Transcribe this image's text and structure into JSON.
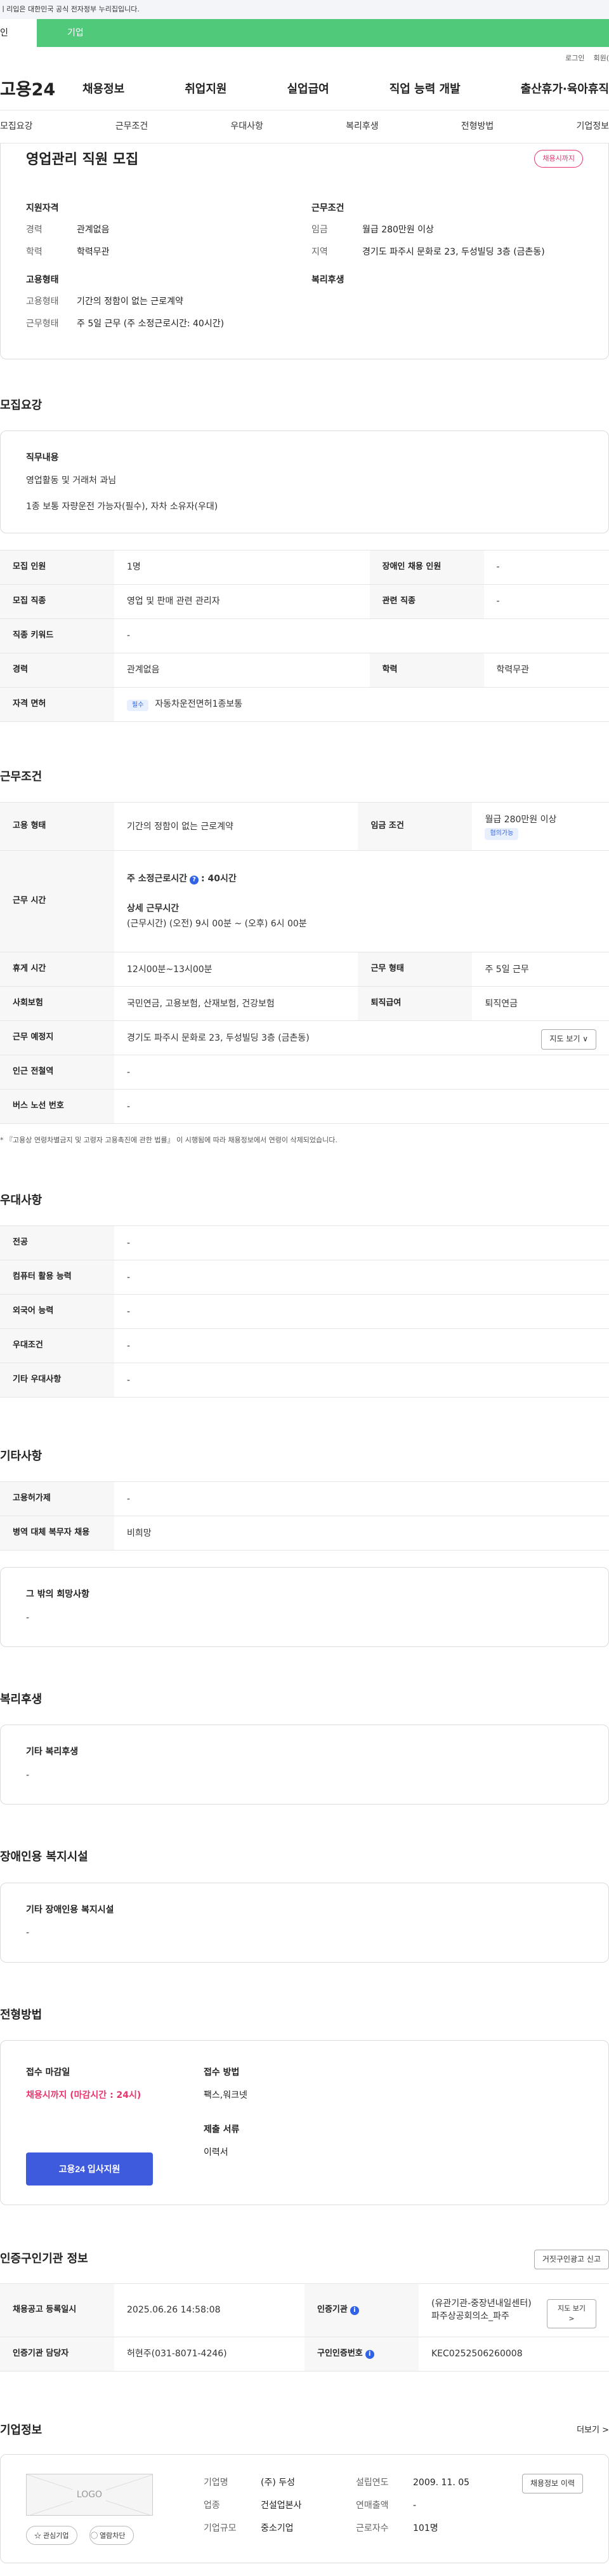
{
  "gov_bar": {
    "text": "ㅣ리입은 대한민국 공식 전자정부 누리집입니다."
  },
  "user_tabs": {
    "individual": "인",
    "company": "기업"
  },
  "util": {
    "login": "로그인",
    "signup": "회원("
  },
  "gnb": {
    "logo": "고용24",
    "items": [
      "채용정보",
      "취업지원",
      "실업급여",
      "직업 능력 개발",
      "출산휴가·육아휴직"
    ]
  },
  "subnav": {
    "items": [
      "모집요강",
      "근무조건",
      "우대사항",
      "복리후생",
      "전형방법",
      "기업정보"
    ]
  },
  "summary": {
    "title": "영업관리 직원 모집",
    "status": "채용시까지",
    "qual": {
      "heading": "지원자격",
      "rows": [
        {
          "k": "경력",
          "v": "관계없음"
        },
        {
          "k": "학력",
          "v": "학력무관"
        }
      ]
    },
    "cond": {
      "heading": "근무조건",
      "rows": [
        {
          "k": "임금",
          "v": "월급 280만원 이상"
        },
        {
          "k": "지역",
          "v": "경기도 파주시 문화로 23, 두성빌딩 3층 (금촌동)"
        }
      ]
    },
    "employ": {
      "heading": "고용형태",
      "rows": [
        {
          "k": "고용형태",
          "v": "기간의 정함이 없는 근로계약"
        },
        {
          "k": "근무형태",
          "v": "주 5일 근무 (주 소정근로시간: 40시간)"
        }
      ]
    },
    "welfare": {
      "heading": "복리후생"
    }
  },
  "recruit": {
    "title": "모집요강",
    "duty": {
      "heading": "직무내용",
      "lines": [
        "영업활동 및 거래처 과님",
        "1종 보통 자량운전 가능자(필수), 자차 소유자(우대)"
      ]
    },
    "rows": [
      {
        "k1": "모집 인원",
        "v1": "1명",
        "k2": "장애인 채용 인원",
        "v2": "-"
      },
      {
        "k1": "모집 직종",
        "v1": "영업 및 판매 관련 관리자",
        "k2": "관련 직종",
        "v2": "-"
      },
      {
        "k1": "직종 키워드",
        "v1": "-"
      },
      {
        "k1": "경력",
        "v1": "관계없음",
        "k2": "학력",
        "v2": "학력무관"
      },
      {
        "k1": "자격 면허",
        "v1": "자동차운전면허1종보통",
        "tag": "필수"
      }
    ]
  },
  "working": {
    "title": "근무조건",
    "employ_type": {
      "k": "고용 형태",
      "v": "기간의 정함이 없는 근로계약"
    },
    "wage": {
      "k": "임금 조건",
      "v": "월급 280만원 이상",
      "tag": "협의가능"
    },
    "hours": {
      "k": "근무 시간",
      "weekly": "주 소정근로시간",
      "weekly_val": ": 40시간",
      "detail_h": "상세 근무시간",
      "detail_v": "(근무시간) (오전) 9시 00분 ~ (오후) 6시 00분"
    },
    "rest": {
      "k": "휴게 시간",
      "v": "12시00분~13시00분",
      "k2": "근무 형태",
      "v2": "주 5일 근무"
    },
    "insurance": {
      "k": "사회보험",
      "v": "국민연금, 고용보험, 산재보험, 건강보험",
      "k2": "퇴직급여",
      "v2": "퇴직연금"
    },
    "place": {
      "k": "근무 예정지",
      "v": "경기도 파주시 문화로 23, 두성빌딩 3층 (금촌동)",
      "btn": "지도 보기 ∨"
    },
    "station": {
      "k": "인근 전철역",
      "v": "-"
    },
    "bus": {
      "k": "버스 노선 번호",
      "v": "-"
    },
    "note": "* 『고용상 연령차별금지 및 고령자 고용촉진에 관한 법률』 이 시행됨에 따라 채용정보에서 연령이 삭제되었습니다."
  },
  "prefer": {
    "title": "우대사항",
    "rows": [
      {
        "k": "전공",
        "v": "-"
      },
      {
        "k": "컴퓨터 활용 능력",
        "v": "-"
      },
      {
        "k": "외국어 능력",
        "v": "-"
      },
      {
        "k": "우대조건",
        "v": "-"
      },
      {
        "k": "기타 우대사항",
        "v": "-"
      }
    ]
  },
  "etc": {
    "title": "기타사항",
    "rows": [
      {
        "k": "고용허가제",
        "v": "-"
      },
      {
        "k": "병역 대체 복무자 채용",
        "v": "비희망"
      }
    ],
    "other": {
      "h": "그 밖의 희망사항",
      "v": "-"
    }
  },
  "welfare": {
    "title": "복리후생",
    "h": "기타 복리후생",
    "v": "-"
  },
  "disabled": {
    "title": "장애인용 복지시설",
    "h": "기타 장애인용 복지시설",
    "v": "-"
  },
  "selection": {
    "title": "전형방법",
    "deadline_h": "접수 마감일",
    "deadline_v": "채용시까지 (마감시간 : 24시)",
    "method_h": "접수 방법",
    "method_v": "팩스,워크넷",
    "docs_h": "제출 서류",
    "docs_v": "이력서",
    "apply_btn": "고용24 입사지원"
  },
  "cert": {
    "title": "인증구인기관 정보",
    "report_btn": "거짓구인광고 신고",
    "r1": {
      "k1": "채용공고 등록일시",
      "v1": "2025.06.26 14:58:08",
      "k2": "인증기관",
      "v2a": "(유관기관-중장년내일센터)",
      "v2b": "파주상공회의소_파주",
      "btn": "지도 보기 >"
    },
    "r2": {
      "k1": "인증기관 담당자",
      "v1": "허현주(031-8071-4246)",
      "k2": "구인인증번호",
      "v2": "KEC0252506260008"
    }
  },
  "company": {
    "title": "기업정보",
    "more": "더보기 >",
    "logo": "LOGO",
    "fav_btn": "☆ 관심기업",
    "block_btn": "⃝ 열람차단",
    "history_btn": "채용정보 이력",
    "rows": [
      {
        "k1": "기업명",
        "v1": "(주) 두성",
        "k2": "설립연도",
        "v2": "2009. 11. 05"
      },
      {
        "k1": "업종",
        "v1": "건설업본사",
        "k2": "연매출액",
        "v2": "-"
      },
      {
        "k1": "기업규모",
        "v1": "중소기업",
        "k2": "근로자수",
        "v2": "101명"
      }
    ]
  }
}
